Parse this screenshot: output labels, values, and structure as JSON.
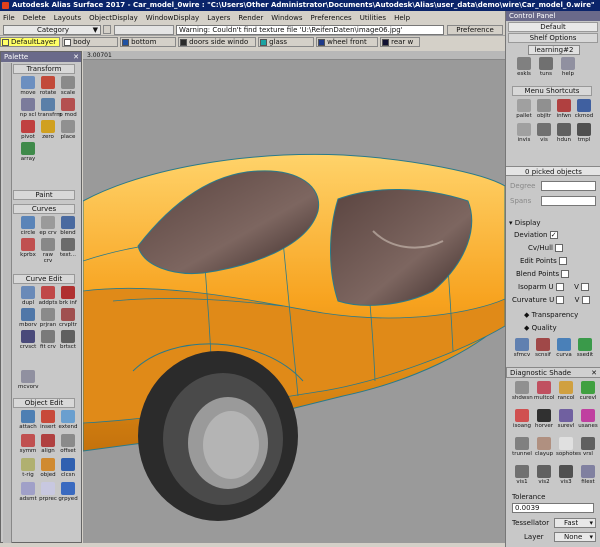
{
  "window": {
    "title": "Autodesk Alias Surface 2017  - Car_model_0wire : \"C:\\Users\\Other Administrator\\Documents\\Autodesk\\Alias\\user_data\\demo\\wire\\Car_model_0.wire\""
  },
  "menu": [
    "File",
    "Delete",
    "Layouts",
    "ObjectDisplay",
    "WindowDisplay",
    "Layers",
    "Render",
    "Windows",
    "Preferences",
    "Utilities",
    "Help"
  ],
  "category": {
    "label": "Category",
    "arrow": "▼"
  },
  "warning": "Warning: Couldn't find texture file 'U:\\ReifenDaten\\image06.jpg'",
  "pref_sets": "Preference Sets",
  "layers": [
    {
      "name": "DefaultLayer",
      "color": "#ffff66"
    },
    {
      "name": "body",
      "color": "#ffffff"
    },
    {
      "name": "bottom",
      "color": "#1f52a3"
    },
    {
      "name": "doors side windo",
      "color": "#2a2a2a"
    },
    {
      "name": "glass",
      "color": "#1ba3a3"
    },
    {
      "name": "wheel front",
      "color": "#1e3a8a"
    },
    {
      "name": "rear w",
      "color": "#111133"
    }
  ],
  "palette": {
    "title": "Palette",
    "sections": [
      "Transform",
      "Paint",
      "Curves",
      "Curve Edit",
      "Object Edit"
    ],
    "transform_tools": [
      "move",
      "rotate",
      "scale",
      "np scl",
      "transfrm",
      "p mod",
      "pivot",
      "zero",
      "place",
      "array"
    ],
    "curve_tools": [
      "circle",
      "ep crv",
      "blend",
      "kprbx",
      "raw crv",
      "text..."
    ],
    "curve_edit_tools": [
      "dupl",
      "addpts",
      "brk inf",
      "mborv",
      "prjran",
      "crvpltr",
      "crvsct",
      "fit crv",
      "brtsct",
      "mcvorv"
    ],
    "object_edit_tools": [
      "attach",
      "insert",
      "extend",
      "symm",
      "align",
      "offset",
      "t-rig",
      "objed",
      "clcsn",
      "adsmt",
      "prprec",
      "grpyed"
    ]
  },
  "viewport": {
    "label": "3.00701"
  },
  "control_panel": {
    "title": "Control Panel",
    "default": "Default",
    "shelf_options": "Shelf Options",
    "learning_tab": "learning#2",
    "learning_tools": [
      "eskls",
      "tuns",
      "help"
    ],
    "menu_shortcuts": "Menu Shortcuts",
    "shortcut_tools": [
      "pallet",
      "objltr",
      "infwn",
      "ckmod",
      "invis",
      "vis",
      "hdun",
      "tmpl"
    ],
    "picked": "0 picked objects",
    "degree": "Degree",
    "spans": "Spans",
    "display": "Display",
    "display_rows": [
      {
        "label": "Deviation",
        "checked": true
      },
      {
        "label": "Cv/Hull",
        "checked": false
      },
      {
        "label": "Edit Points",
        "checked": false
      },
      {
        "label": "Blend Points",
        "checked": false
      },
      {
        "label": "Isoparm U",
        "checked": false,
        "v": "V"
      },
      {
        "label": "Curvature U",
        "checked": false,
        "v": "V"
      }
    ],
    "transparency": "Transparency",
    "quality": "Quality",
    "bottom_tools": [
      "sfmcv",
      "scnsif",
      "curva",
      "ssedit"
    ],
    "diag_title": "Diagnostic Shade",
    "diag_tools": [
      "shdwsn",
      "multcol",
      "rancol",
      "curevl",
      "isoang",
      "horver",
      "surevl",
      "usanes",
      "trunnel",
      "clayup",
      "sophotes",
      "vrsl",
      "vis1",
      "vis2",
      "vis3",
      "filest"
    ],
    "tolerance": "Tolerance",
    "tolerance_value": "0.0039",
    "tessellator": "Tessellator",
    "tessellator_value": "Fast",
    "layer": "Layer",
    "layer_value": "None"
  }
}
